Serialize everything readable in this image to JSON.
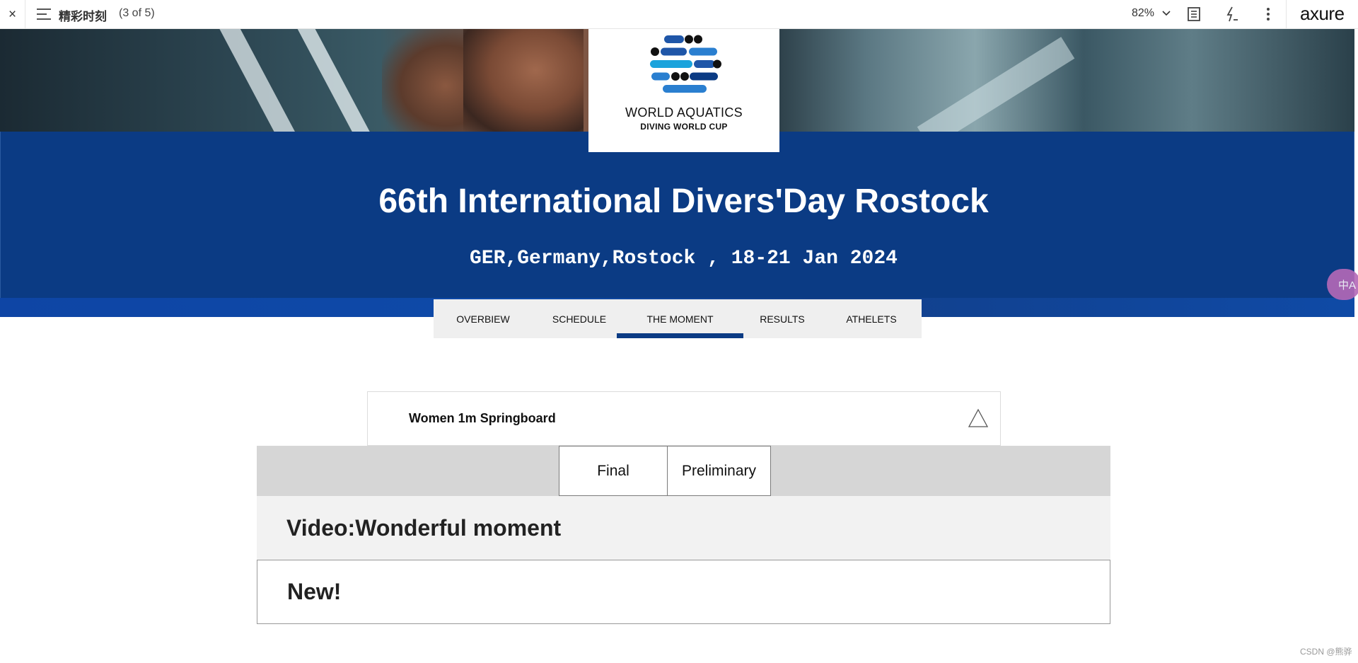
{
  "viewer": {
    "close_glyph": "×",
    "page_title": "精彩时刻",
    "page_count": "(3 of 5)",
    "zoom": "82%",
    "logo": "axure",
    "icons": [
      "close-icon",
      "menu-icon",
      "chevron-down-icon",
      "notes-icon",
      "lightning-icon",
      "more-vertical-icon"
    ]
  },
  "event": {
    "logo_line1": "WORLD AQUATICS",
    "logo_line2": "DIVING WORLD CUP",
    "title": "66th International Divers'Day Rostock",
    "subtitle": "GER,Germany,Rostock , 18-21 Jan 2024",
    "brand_color": "#0b3b84"
  },
  "tabs": [
    {
      "label": "OVERBIEW"
    },
    {
      "label": "SCHEDULE"
    },
    {
      "label": "THE MOMENT",
      "active": true
    },
    {
      "label": "RESULTS"
    },
    {
      "label": "ATHELETS"
    }
  ],
  "discipline": {
    "selected": "Women 1m Springboard"
  },
  "rounds": [
    "Final",
    "Preliminary"
  ],
  "sections": {
    "video_title": "Video:Wonderful moment",
    "new_title": "New!"
  },
  "translate_badge": "中A",
  "watermark": "CSDN @熊骅"
}
